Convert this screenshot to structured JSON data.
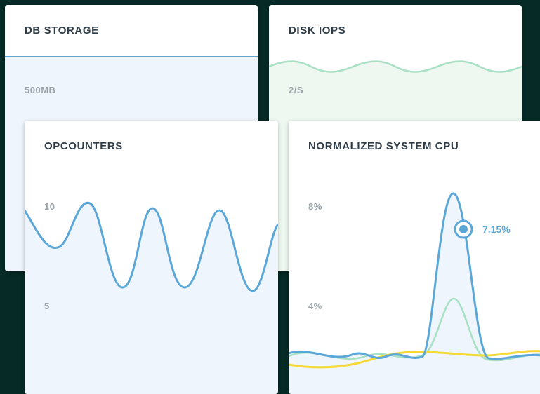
{
  "cards": {
    "db_storage": {
      "title": "DB STORAGE",
      "tick": "500MB"
    },
    "disk_iops": {
      "title": "DISK IOPS",
      "tick": "2/S"
    },
    "opcounters": {
      "title": "OPCOUNTERS",
      "ticks": [
        "10",
        "5"
      ]
    },
    "cpu": {
      "title": "NORMALIZED SYSTEM CPU",
      "ticks": [
        "8%",
        "4%"
      ],
      "callout": "7.15%"
    }
  },
  "colors": {
    "background": "#062a26",
    "blue_line": "#5ba7d8",
    "blue_fill": "#eef5fc",
    "green_line": "#a8e0c4",
    "green_fill": "#eef8f1",
    "yellow_line": "#f5d934"
  }
}
